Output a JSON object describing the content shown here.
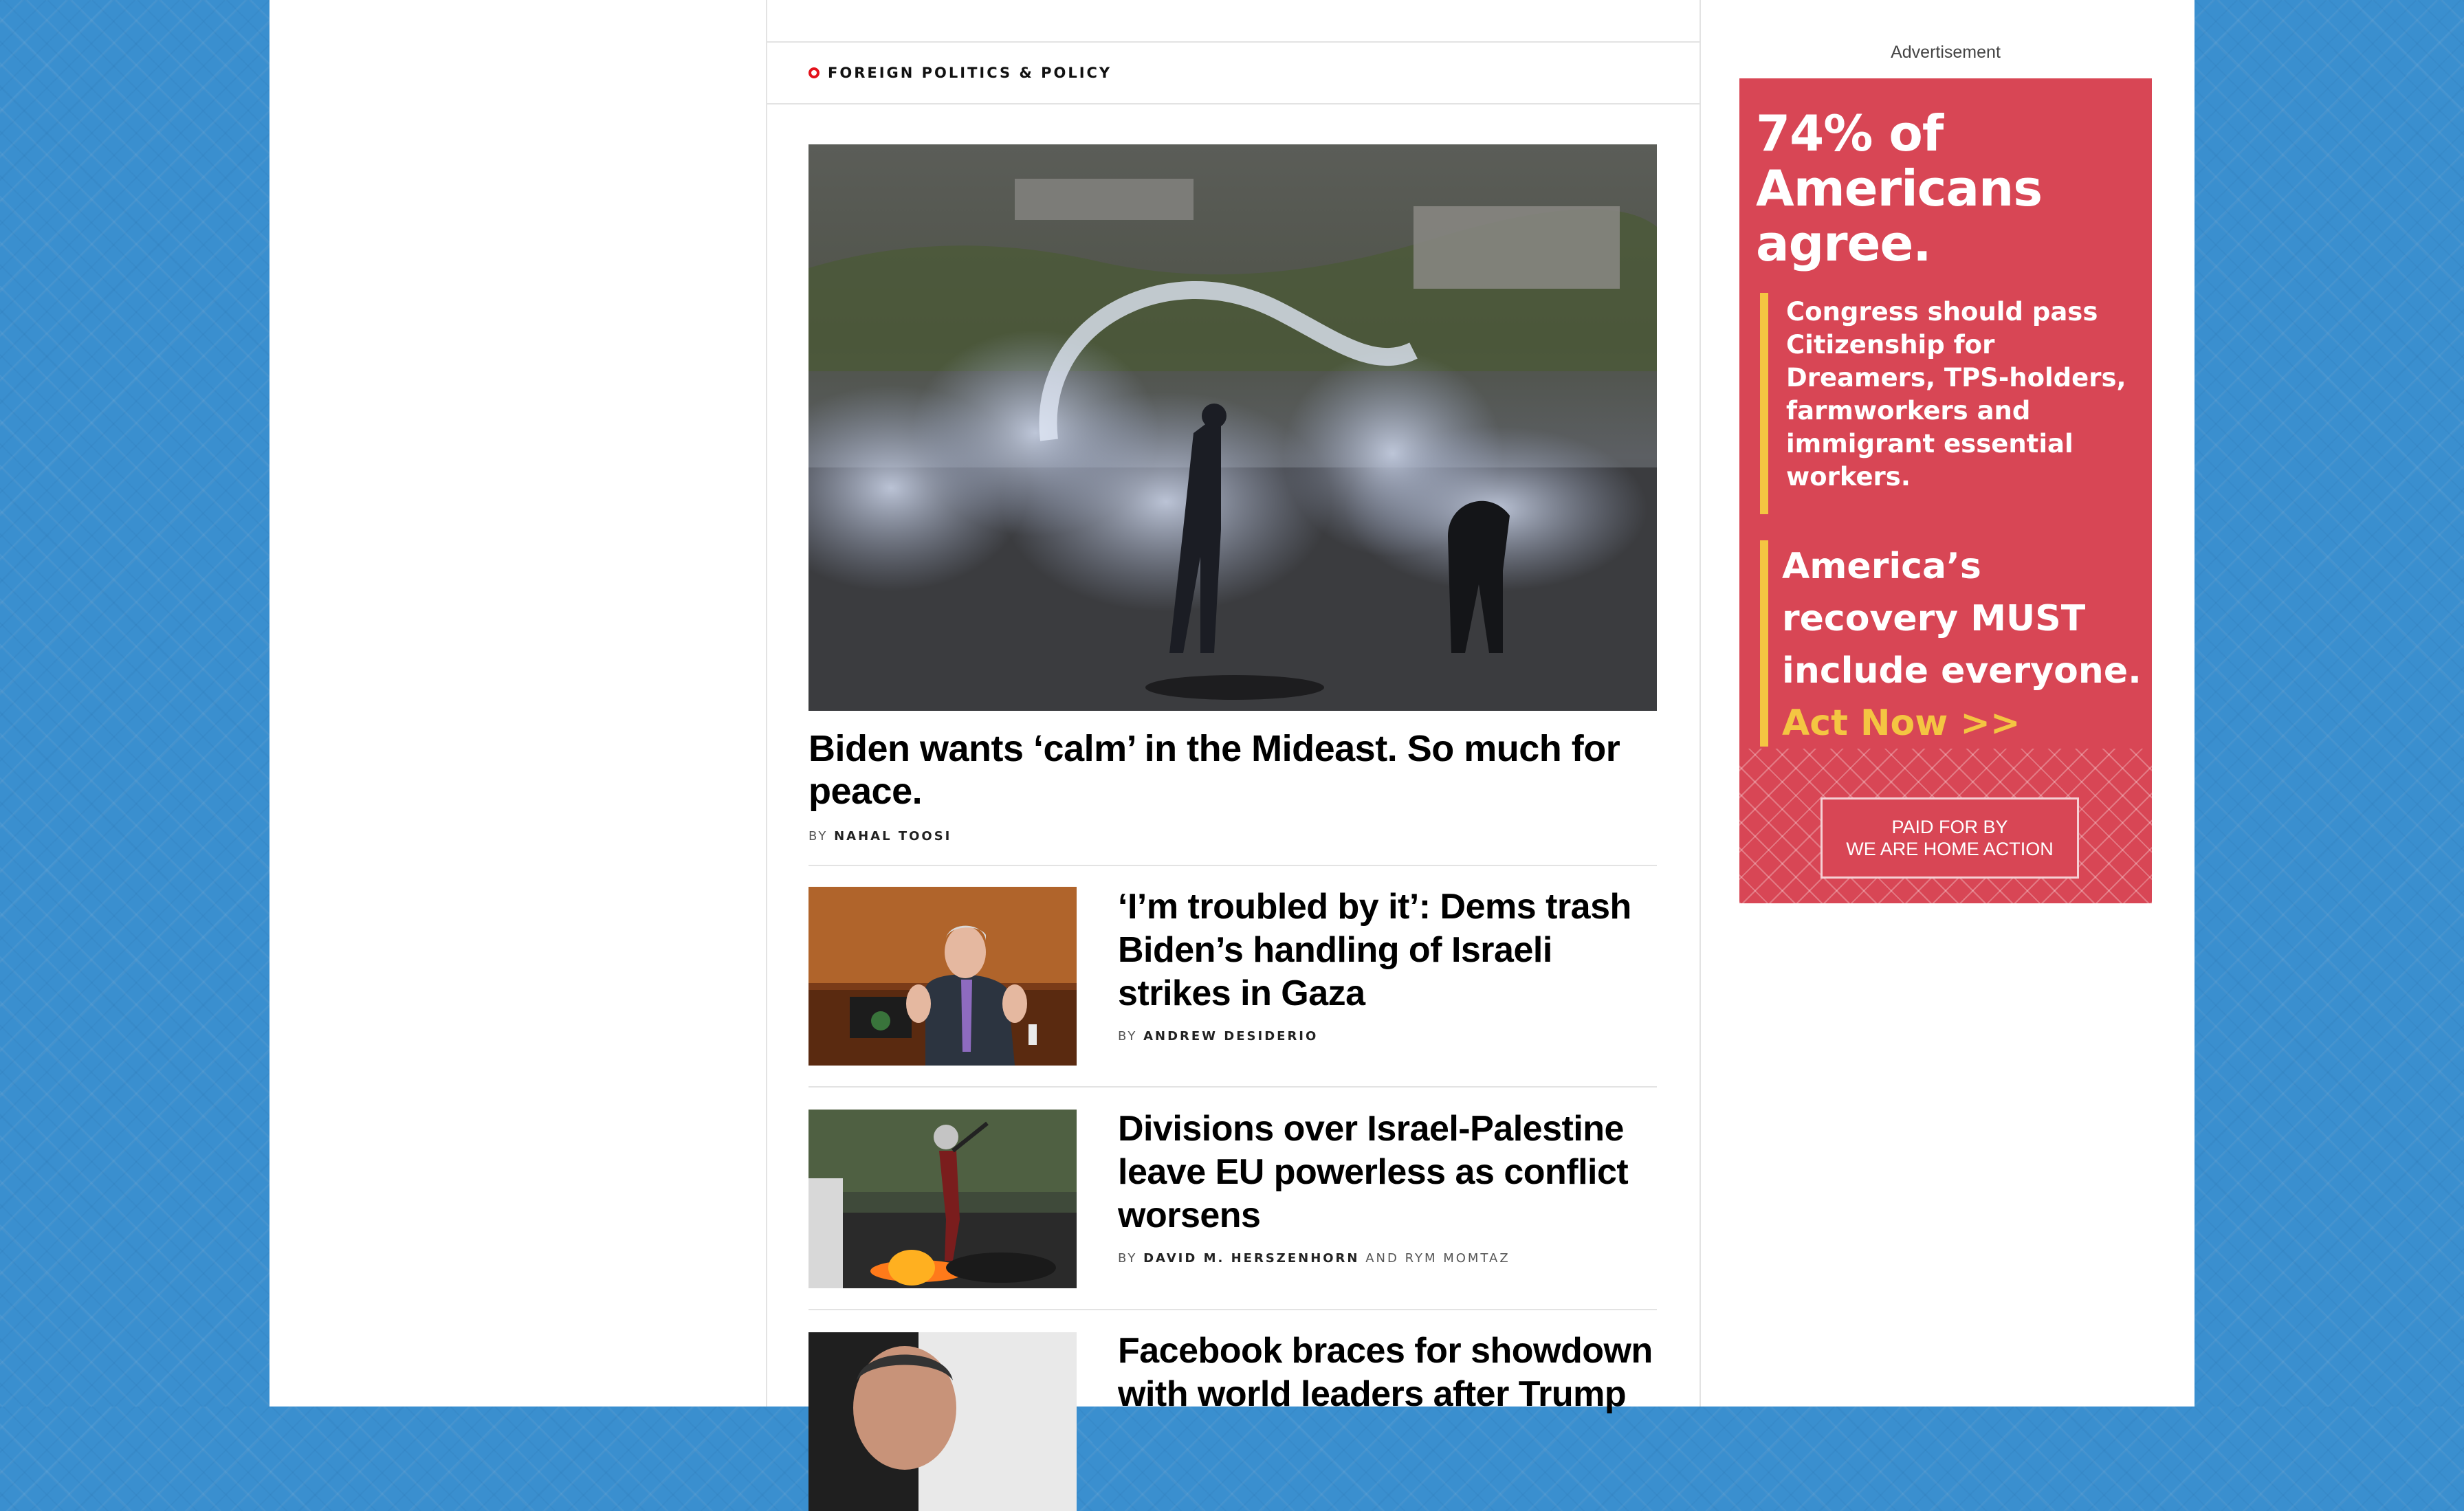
{
  "section": {
    "title": "FOREIGN POLITICS & POLICY"
  },
  "lead_story": {
    "headline": "Biden wants ‘calm’ in the Mideast. So much for peace.",
    "by": "BY",
    "author": "NAHAL TOOSI",
    "image_icon": "photo-tear-gas-protest"
  },
  "stories": [
    {
      "headline": "‘I’m troubled by it’: Dems trash Biden’s handling of Israeli strikes in Gaza",
      "by": "BY",
      "author": "ANDREW DESIDERIO",
      "and": "",
      "coauthor": "",
      "image_icon": "photo-senator-speaking"
    },
    {
      "headline": "Divisions over Israel-Palestine leave EU powerless as conflict worsens",
      "by": "BY",
      "author": "DAVID M. HERSZENHORN",
      "and": "AND",
      "coauthor": "RYM MOMTAZ",
      "image_icon": "photo-protester-fire"
    },
    {
      "headline": "Facebook braces for showdown with world leaders after Trump",
      "by": "",
      "author": "",
      "and": "",
      "coauthor": "",
      "image_icon": "photo-portrait"
    }
  ],
  "ad": {
    "label": "Advertisement",
    "headline_line1": "74% of",
    "headline_line2": "Americans",
    "headline_line3": "agree.",
    "block1": "Congress should pass Citizenship for Dreamers, TPS-holders, farmworkers and immigrant essential workers.",
    "block2": "America’s recovery MUST include everyone.",
    "cta": "Act Now >>",
    "paid_line1": "PAID FOR BY",
    "paid_line2": "WE ARE HOME ACTION",
    "colors": {
      "background": "#d84655",
      "accent": "#f4c542"
    }
  },
  "colors": {
    "page_background": "#3a8fcf",
    "section_dot": "#e3121b"
  }
}
